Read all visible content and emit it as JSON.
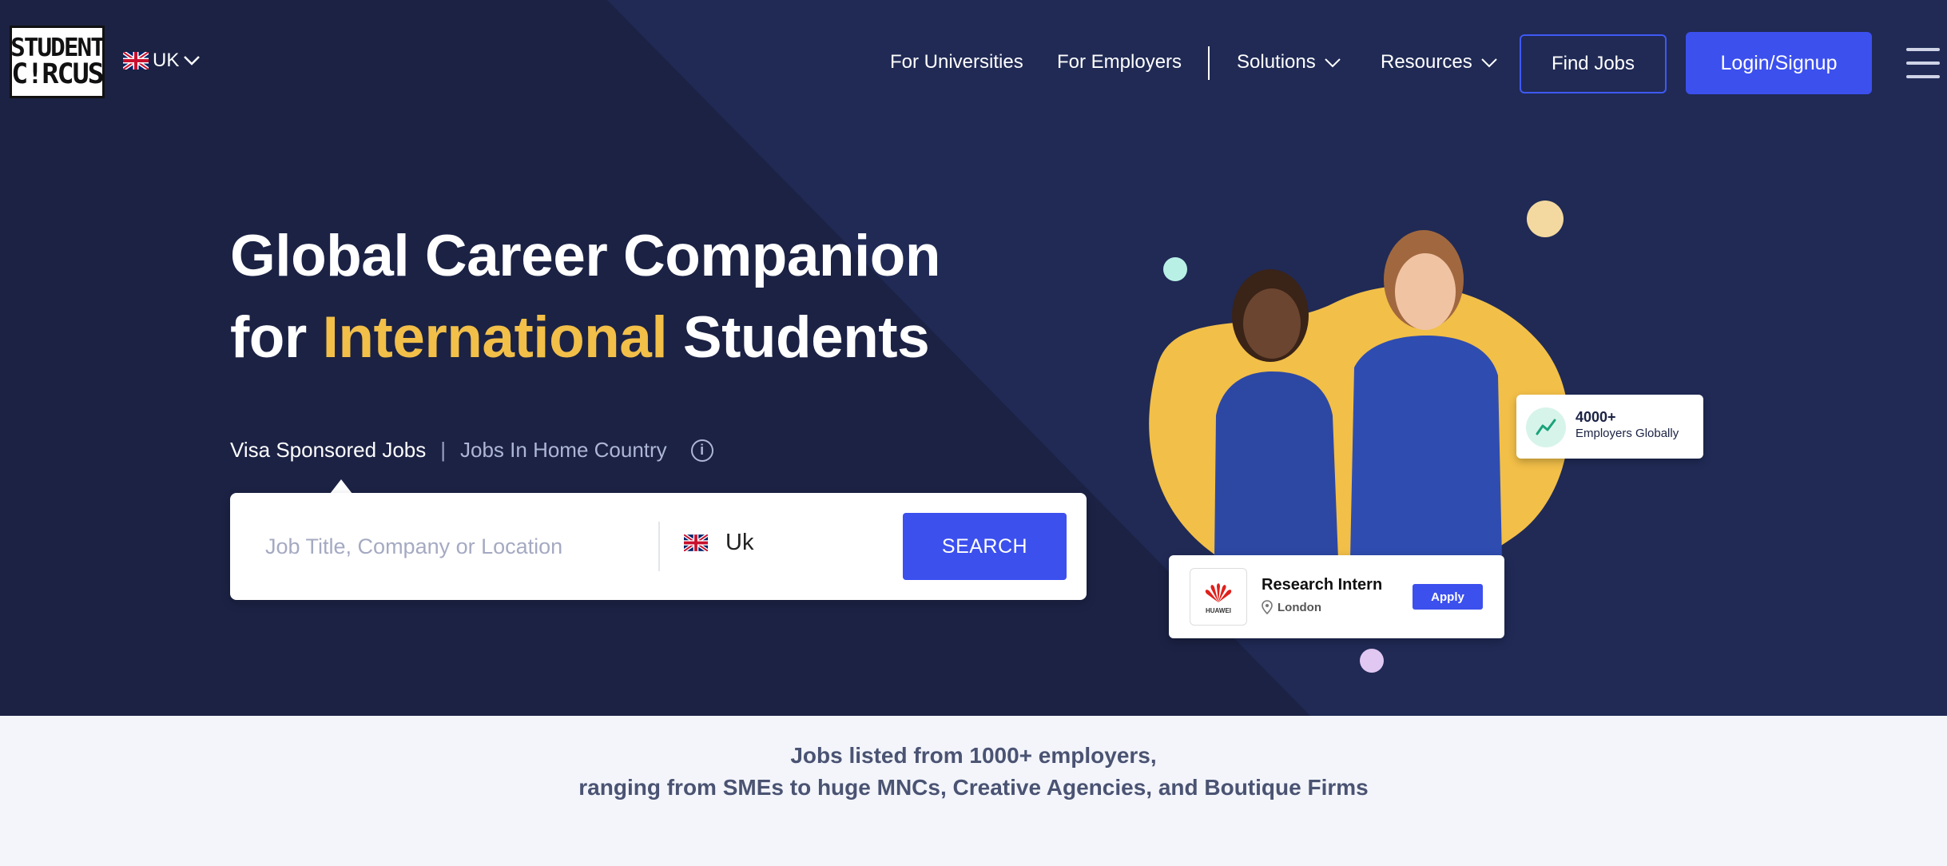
{
  "brand": {
    "logo_line1": "STUDENT",
    "logo_line2": "C!RCUS"
  },
  "region": {
    "label": "UK"
  },
  "nav": {
    "universities": "For Universities",
    "employers": "For Employers",
    "solutions": "Solutions",
    "resources": "Resources",
    "find_jobs": "Find Jobs",
    "login": "Login/Signup"
  },
  "hero": {
    "line1": "Global Career Companion",
    "line2_pre": "for ",
    "line2_accent": "International",
    "line2_post": " Students"
  },
  "modes": {
    "active": "Visa Sponsored Jobs",
    "separator": "|",
    "inactive": "Jobs In Home Country",
    "info": "i"
  },
  "search": {
    "placeholder": "Job Title, Company or Location",
    "country": "Uk",
    "button": "SEARCH"
  },
  "cards": {
    "employers_count": "4000+",
    "employers_label": "Employers Globally",
    "job_title": "Research Intern",
    "job_location": "London",
    "job_company": "HUAWEI",
    "apply": "Apply"
  },
  "tagline": {
    "line1": "Jobs listed from 1000+ employers,",
    "line2": "ranging from SMEs to huge MNCs, Creative Agencies, and Boutique Firms"
  },
  "colors": {
    "hero_bg": "#1b2244",
    "accent_yellow": "#f2bf48",
    "primary_blue": "#3c50ee",
    "section_bg": "#f3f5fb"
  }
}
